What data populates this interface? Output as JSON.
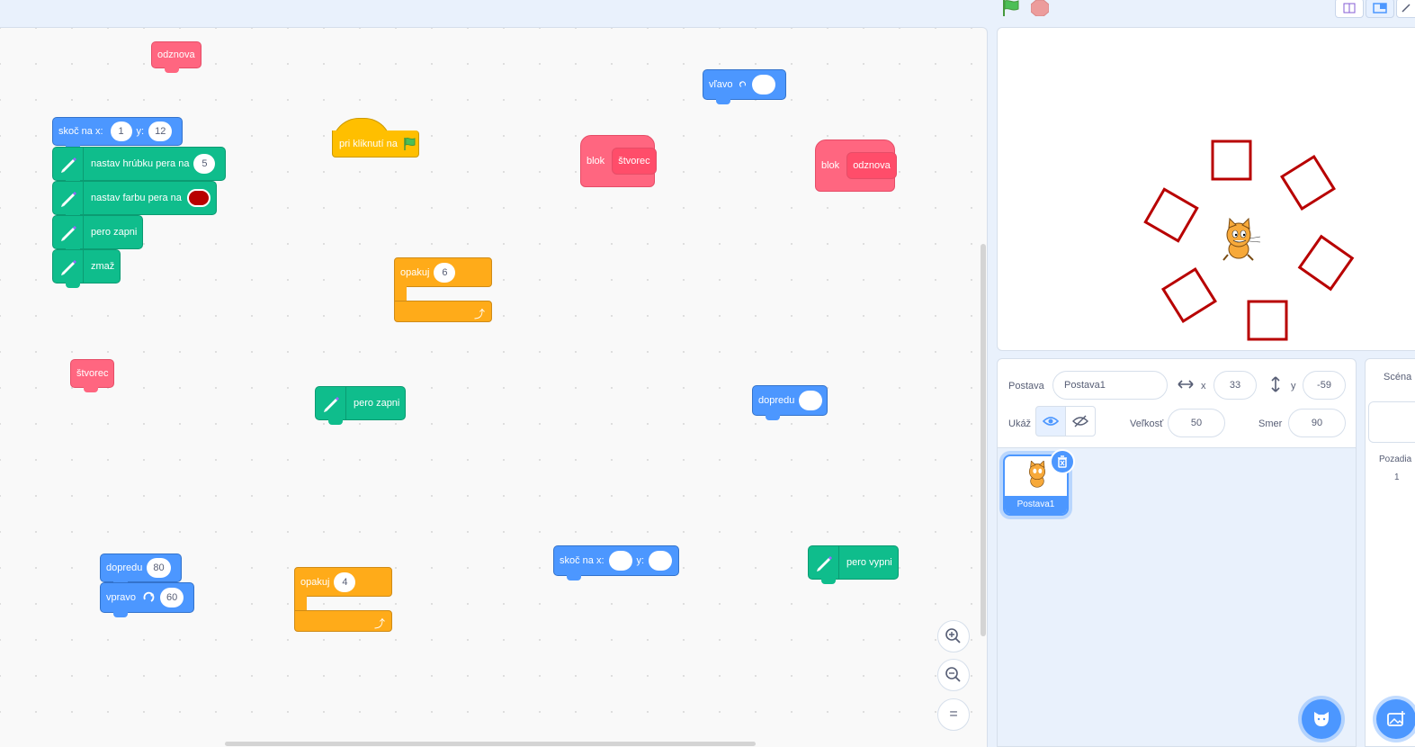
{
  "workspace": {
    "blocks": {
      "odznova_top": "odznova",
      "goto_label_x": "skoč na x:",
      "goto_x": "1",
      "goto_label_y": "y:",
      "goto_y": "12",
      "pen_size_label": "nastav hrúbku pera na",
      "pen_size_value": "5",
      "pen_color_label": "nastav farbu pera na",
      "pen_color_value": "#b80000",
      "pen_down_1": "pero zapni",
      "clear": "zmaž",
      "hat_label": "pri kliknutí na",
      "define1_label": "blok",
      "define1_name": "štvorec",
      "define2_label": "blok",
      "define2_name": "odznova",
      "turn_left_label": "vľavo",
      "repeat1_label": "opakuj",
      "repeat1_value": "6",
      "stvorec_call": "štvorec",
      "pen_down_2": "pero zapni",
      "forward_label_1": "dopredu",
      "forward_label_2": "dopredu",
      "forward_value_2": "80",
      "turn_right_label": "vpravo",
      "turn_right_value": "60",
      "repeat2_label": "opakuj",
      "repeat2_value": "4",
      "goto2_label_x": "skoč na x:",
      "goto2_label_y": "y:",
      "pen_up": "pero vypni"
    }
  },
  "sprite_info": {
    "sprite_label": "Postava",
    "sprite_name": "Postava1",
    "x_label": "x",
    "x_value": "33",
    "y_label": "y",
    "y_value": "-59",
    "show_label": "Ukáž",
    "size_label": "Veľkosť",
    "size_value": "50",
    "direction_label": "Smer",
    "direction_value": "90"
  },
  "sprite_list": {
    "items": [
      {
        "name": "Postava1"
      }
    ]
  },
  "scene_panel": {
    "title": "Scéna",
    "backdrops_label": "Pozadia",
    "backdrops_count": "1"
  },
  "colors": {
    "motion": "#4c97ff",
    "pen": "#0fbd8c",
    "custom": "#ff6680",
    "control": "#ffab19",
    "events": "#ffbf00",
    "square_red": "#b80000"
  }
}
